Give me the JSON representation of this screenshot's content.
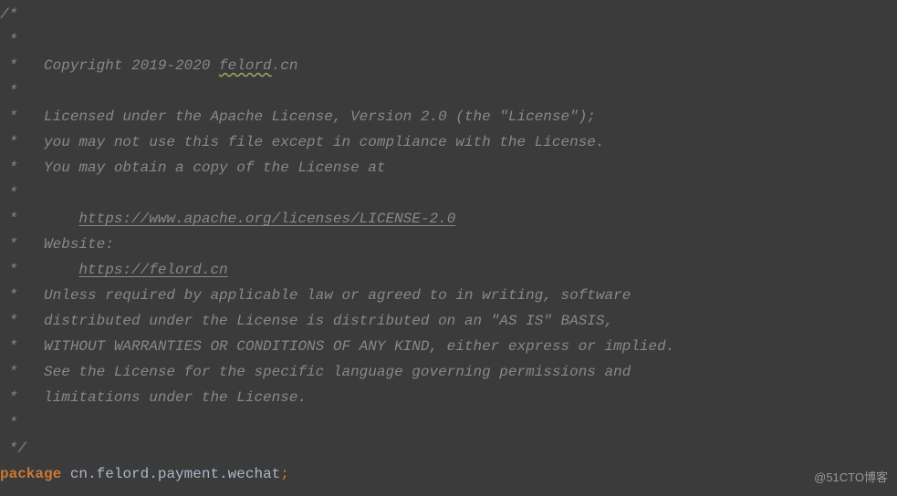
{
  "code": {
    "l01": "/*",
    "l02": " *",
    "l03a": " *   Copyright 2019-2020 ",
    "l03b": "felord",
    "l03c": ".cn",
    "l04": " *",
    "l05": " *   Licensed under the Apache License, Version 2.0 (the \"License\");",
    "l06": " *   you may not use this file except in compliance with the License.",
    "l07": " *   You may obtain a copy of the License at",
    "l08": " *",
    "l09a": " *       ",
    "l09b": "https://www.apache.org/licenses/LICENSE-2.0",
    "l10": " *   Website:",
    "l11a": " *       ",
    "l11b": "https://felord.cn",
    "l12": " *   Unless required by applicable law or agreed to in writing, software",
    "l13": " *   distributed under the License is distributed on an \"AS IS\" BASIS,",
    "l14": " *   WITHOUT WARRANTIES OR CONDITIONS OF ANY KIND, either express or implied.",
    "l15": " *   See the License for the specific language governing permissions and",
    "l16": " *   limitations under the License.",
    "l17": " *",
    "l18": " */",
    "l19_keyword": "package",
    "l19_space": " ",
    "l19_package": "cn.felord.payment.wechat",
    "l19_semi": ";"
  },
  "watermark": "@51CTO博客"
}
